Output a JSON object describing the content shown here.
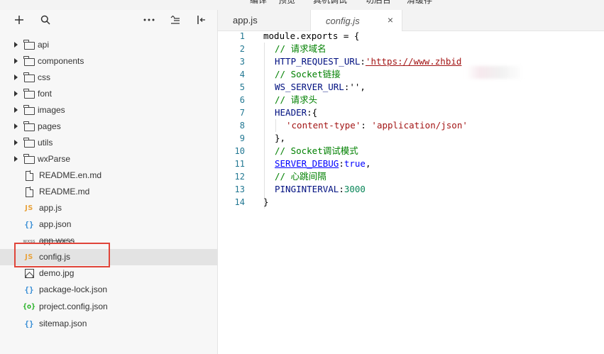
{
  "top_menu": [
    "编译",
    "预览",
    "真机调试",
    "切后台",
    "清缓存"
  ],
  "sidebar": {
    "toolbar": {
      "add": "+",
      "search": "search",
      "more": "more",
      "collapse": "collapse",
      "split": "split"
    },
    "items": [
      {
        "type": "folder",
        "label": "api"
      },
      {
        "type": "folder",
        "label": "components"
      },
      {
        "type": "folder",
        "label": "css"
      },
      {
        "type": "folder",
        "label": "font"
      },
      {
        "type": "folder",
        "label": "images"
      },
      {
        "type": "folder",
        "label": "pages"
      },
      {
        "type": "folder",
        "label": "utils"
      },
      {
        "type": "folder",
        "label": "wxParse"
      },
      {
        "type": "md",
        "label": "README.en.md"
      },
      {
        "type": "md",
        "label": "README.md"
      },
      {
        "type": "js",
        "label": "app.js",
        "icon_text": "JS"
      },
      {
        "type": "json",
        "label": "app.json",
        "icon_text": "{}"
      },
      {
        "type": "wxss",
        "label": "app.wxss",
        "icon_text": "wxss"
      },
      {
        "type": "js",
        "label": "config.js",
        "icon_text": "JS",
        "selected": true
      },
      {
        "type": "image",
        "label": "demo.jpg"
      },
      {
        "type": "json",
        "label": "package-lock.json",
        "icon_text": "{}"
      },
      {
        "type": "config",
        "label": "project.config.json",
        "icon_text": "{o}"
      },
      {
        "type": "json",
        "label": "sitemap.json",
        "icon_text": "{}"
      }
    ]
  },
  "editor": {
    "tabs": [
      {
        "label": "app.js",
        "active": false
      },
      {
        "label": "config.js",
        "active": true,
        "close": "×"
      }
    ],
    "line_numbers": [
      "1",
      "2",
      "3",
      "4",
      "5",
      "6",
      "7",
      "8",
      "9",
      "10",
      "11",
      "12",
      "13",
      "14"
    ],
    "code": {
      "l1": "module.exports = {",
      "l2": "// 请求域名",
      "l3_key": "HTTP_REQUEST_URL",
      "l3_colon": ":",
      "l3_val": "'https://www.zhbid",
      "l4": "// Socket链接",
      "l5_key": "WS_SERVER_URL",
      "l5_rest": ":'',",
      "l6": "// 请求头",
      "l7_key": "HEADER",
      "l7_rest": ":{",
      "l8_key": "'content-type'",
      "l8_colon": ": ",
      "l8_val": "'application/json'",
      "l9": "},",
      "l10": "// Socket调试模式",
      "l11_key": "SERVER_DEBUG",
      "l11_colon": ":",
      "l11_val": "true",
      "l11_end": ",",
      "l12": "// 心跳间隔",
      "l13_key": "PINGINTERVAL",
      "l13_colon": ":",
      "l13_val": "3000",
      "l14": "}"
    }
  },
  "colors": {
    "comment": "#008000",
    "string": "#a31515",
    "number": "#098658",
    "keyword": "#0000ff",
    "line_number": "#237893",
    "highlight_box": "#e0453a",
    "js_icon": "#e8a33d",
    "json_icon": "#3a8fd6"
  }
}
